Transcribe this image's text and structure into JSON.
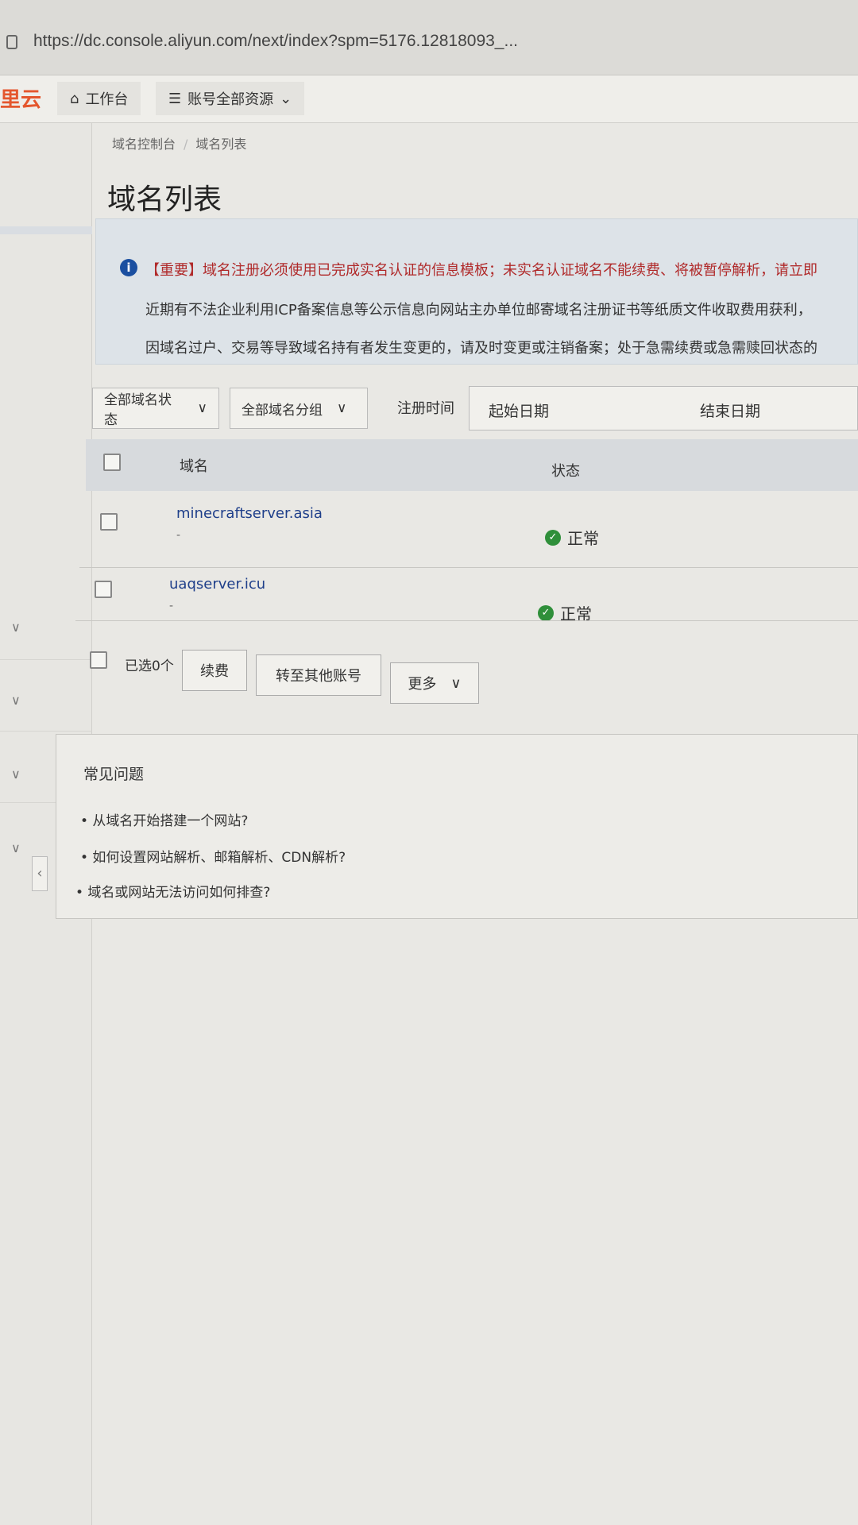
{
  "browser": {
    "url": "https://dc.console.aliyun.com/next/index?spm=5176.12818093_..."
  },
  "topnav": {
    "logo": "里云",
    "workbench": "工作台",
    "resources": "账号全部资源"
  },
  "breadcrumb": {
    "root": "域名控制台",
    "sep": "/",
    "current": "域名列表"
  },
  "page_title": "域名列表",
  "notice": {
    "tag": "【重要】",
    "line1": "域名注册必须使用已完成实名认证的信息模板；未实名认证域名不能续费、将被暂停解析，请立即",
    "line2": "近期有不法企业利用ICP备案信息等公示信息向网站主办单位邮寄域名注册证书等纸质文件收取费用获利，",
    "line3": "因域名过户、交易等导致域名持有者发生变更的，请及时变更或注销备案；处于急需续费或急需赎回状态的"
  },
  "filters": {
    "status": "全部域名状态",
    "group": "全部域名分组",
    "reg_time_label": "注册时间",
    "start_placeholder": "起始日期",
    "end_placeholder": "结束日期"
  },
  "table": {
    "headers": {
      "domain": "域名",
      "status": "状态"
    },
    "rows": [
      {
        "domain": "minecraftserver.asia",
        "sub": "-",
        "status": "正常"
      },
      {
        "domain": "uaqserver.icu",
        "sub": "-",
        "status": "正常"
      }
    ]
  },
  "batch": {
    "selected": "已选0个",
    "renew": "续费",
    "transfer": "转至其他账号",
    "more": "更多"
  },
  "faq": {
    "title": "常见问题",
    "items": [
      "• 从域名开始搭建一个网站?",
      "• 如何设置网站解析、邮箱解析、CDN解析?",
      "• 域名或网站无法访问如何排查?"
    ]
  },
  "colors": {
    "link": "#1f3f8a",
    "warning": "#b02a2a",
    "success": "#2f8f3a",
    "logo": "#e4572e"
  }
}
